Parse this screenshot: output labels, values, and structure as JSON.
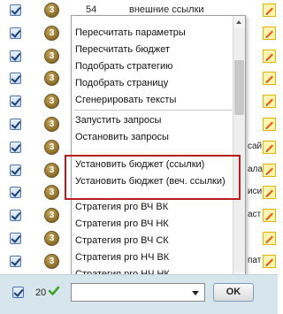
{
  "rows": [
    {
      "badge": "3",
      "num": "54",
      "label": "внешние ссылки",
      "peek": ""
    },
    {
      "badge": "3",
      "num": "",
      "label": "",
      "peek": ""
    },
    {
      "badge": "3",
      "num": "",
      "label": "",
      "peek": ""
    },
    {
      "badge": "3",
      "num": "",
      "label": "",
      "peek": ""
    },
    {
      "badge": "3",
      "num": "",
      "label": "",
      "peek": ""
    },
    {
      "badge": "3",
      "num": "",
      "label": "",
      "peek": ""
    },
    {
      "badge": "3",
      "num": "",
      "label": "",
      "peek": "сай"
    },
    {
      "badge": "3",
      "num": "",
      "label": "",
      "peek": "ала"
    },
    {
      "badge": "3",
      "num": "",
      "label": "",
      "peek": "иси"
    },
    {
      "badge": "3",
      "num": "",
      "label": "",
      "peek": "аст"
    },
    {
      "badge": "3",
      "num": "",
      "label": "",
      "peek": ""
    },
    {
      "badge": "3",
      "num": "",
      "label": "",
      "peek": "пат"
    }
  ],
  "dropdown": {
    "group1": [
      "Пересчитать параметры",
      "Пересчитать бюджет",
      "Подобрать стратегию",
      "Подобрать страницу",
      "Сгенерировать тексты"
    ],
    "group2": [
      "Запустить запросы",
      "Остановить запросы"
    ],
    "group3": [
      "Установить бюджет (ссылки)",
      "Установить бюджет (веч. ссылки)"
    ],
    "group4": [
      "Стратегия pro ВЧ ВК",
      "Стратегия pro ВЧ НК",
      "Стратегия pro ВЧ СК",
      "Стратегия pro НЧ ВК",
      "Стратегия pro НЧ НК"
    ]
  },
  "footer": {
    "count": "20",
    "select_value": "",
    "ok_label": "OK"
  },
  "colors": {
    "highlight": "#b81c1c",
    "footer_bg": "#d7e6ec"
  }
}
